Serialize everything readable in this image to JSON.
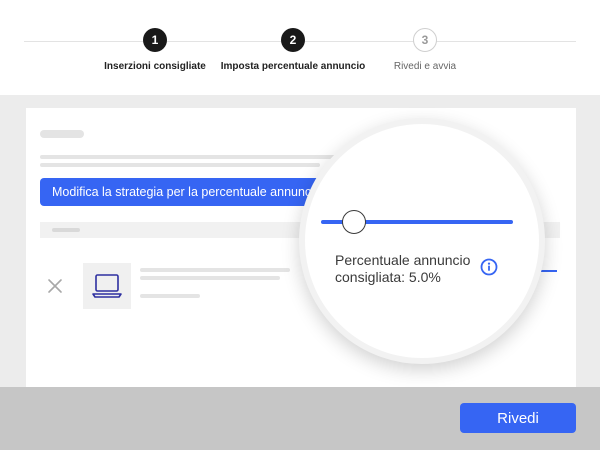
{
  "stepper": {
    "steps": [
      {
        "number": "1",
        "label": "Inserzioni consigliate",
        "state": "done"
      },
      {
        "number": "2",
        "label": "Imposta percentuale annuncio",
        "state": "current"
      },
      {
        "number": "3",
        "label": "Rivedi e avvia",
        "state": "todo"
      }
    ]
  },
  "strategy_button_label": "Modifica la strategia per la percentuale annuncio",
  "magnifier": {
    "recommended_label": "Percentuale annuncio consigliata: 5.0%",
    "slider_level_percent": 10
  },
  "icons": {
    "close": "close-icon",
    "item_thumbnail": "laptop-icon",
    "info": "info-icon"
  },
  "colors": {
    "accent": "#3665f3",
    "step_done": "#191919",
    "bottom_bar": "#c6c6c6",
    "background_area": "#ececec"
  },
  "footer": {
    "review_label": "Rivedi"
  }
}
